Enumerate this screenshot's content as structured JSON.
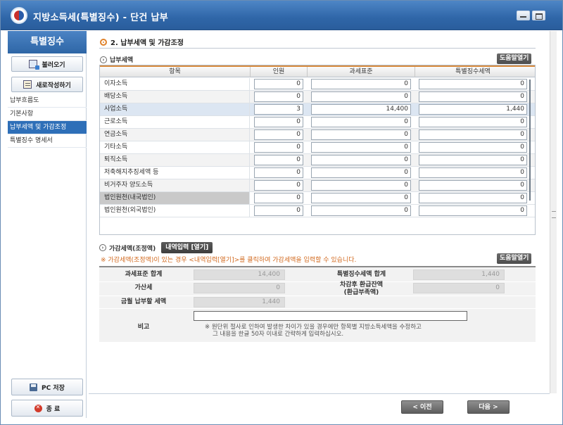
{
  "window": {
    "title": "지방소득세(특별징수) - 단건 납부"
  },
  "sidebar": {
    "header": "특별징수",
    "load_label": "불러오기",
    "new_label": "새로작성하기",
    "menu": [
      {
        "label": "납부흐름도"
      },
      {
        "label": "기본사항"
      },
      {
        "label": "납부세액 및 가감조정"
      },
      {
        "label": "특별징수 명세서"
      }
    ],
    "pc_save_label": "PC 저장",
    "exit_label": "종 료"
  },
  "main": {
    "section_title": "2. 납부세액 및 가감조정",
    "tax_subtitle": "납부세액",
    "help_label": "도움말열기",
    "table": {
      "headers": [
        "항목",
        "인원",
        "과세표준",
        "특별징수세액"
      ],
      "rows": [
        {
          "label": "이자소득",
          "count": "0",
          "base": "0",
          "tax": "0"
        },
        {
          "label": "배당소득",
          "count": "0",
          "base": "0",
          "tax": "0"
        },
        {
          "label": "사업소득",
          "count": "3",
          "base": "14,400",
          "tax": "1,440"
        },
        {
          "label": "근로소득",
          "count": "0",
          "base": "0",
          "tax": "0"
        },
        {
          "label": "연금소득",
          "count": "0",
          "base": "0",
          "tax": "0"
        },
        {
          "label": "기타소득",
          "count": "0",
          "base": "0",
          "tax": "0"
        },
        {
          "label": "퇴직소득",
          "count": "0",
          "base": "0",
          "tax": "0"
        },
        {
          "label": "저축해지추징세액 등",
          "count": "0",
          "base": "0",
          "tax": "0"
        },
        {
          "label": "비거주자 양도소득",
          "count": "0",
          "base": "0",
          "tax": "0"
        },
        {
          "label": "법인원천(내국법인)",
          "count": "0",
          "base": "0",
          "tax": "0"
        },
        {
          "label": "법인원천(외국법인)",
          "count": "0",
          "base": "0",
          "tax": "0"
        }
      ]
    },
    "adjust": {
      "subtitle": "가감세액(조정액)",
      "open_label": "내역입력 [열기]",
      "notice": "※ 가감세액(조정액)이 있는 경우 <내역입력[열기]>를 클릭하여 가감세액을 입력할 수 있습니다.",
      "help_label": "도움말열기"
    },
    "summary": {
      "base_total_label": "과세표준 합계",
      "base_total": "14,400",
      "tax_total_label": "특별징수세액 합계",
      "tax_total": "1,440",
      "penalty_label": "가산세",
      "penalty": "0",
      "refund_label_1": "차감후 환급잔액",
      "refund_label_2": "(환급부족액)",
      "refund": "0",
      "payable_label": "금월 납부할 세액",
      "payable": "1,440",
      "memo_label": "비고",
      "memo_value": "",
      "memo_note_1": "※ 원단위 절사로 인하여 발생한 차이가 있을 경우에만 항목별 지방소득세액을 수정하고",
      "memo_note_2": "그 내용을 한글 50자 이내로 간략하게 입력하십시오."
    }
  },
  "footer": {
    "prev_label": "< 이전",
    "next_label": "다음 >"
  }
}
